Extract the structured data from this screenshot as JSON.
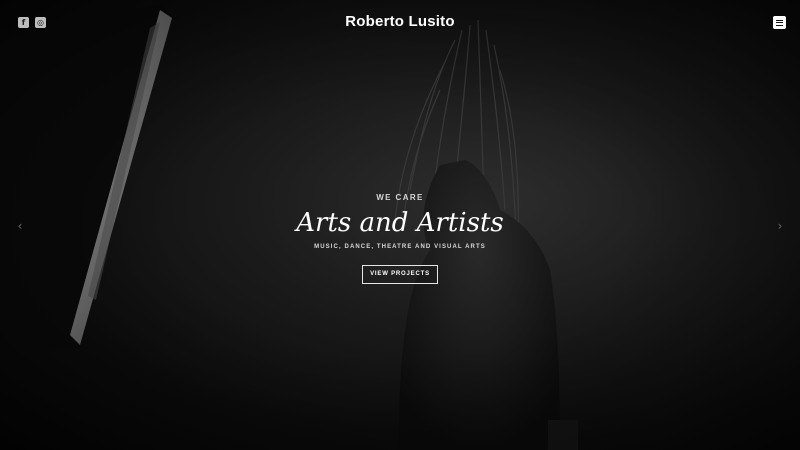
{
  "header": {
    "brand": "Roberto Lusito",
    "social": [
      {
        "name": "facebook-icon",
        "glyph": "f"
      },
      {
        "name": "instagram-icon",
        "glyph": "◎"
      }
    ],
    "menu_icon": "hamburger-menu-icon"
  },
  "hero": {
    "eyebrow": "WE CARE",
    "title": "Arts and Artists",
    "subtitle": "MUSIC, DANCE, THEATRE AND VISUAL ARTS",
    "cta_label": "VIEW PROJECTS"
  },
  "slider": {
    "prev_glyph": "‹",
    "next_glyph": "›"
  },
  "colors": {
    "background": "#0c0c0c",
    "text": "#ffffff",
    "muted": "#d6d6d6"
  }
}
